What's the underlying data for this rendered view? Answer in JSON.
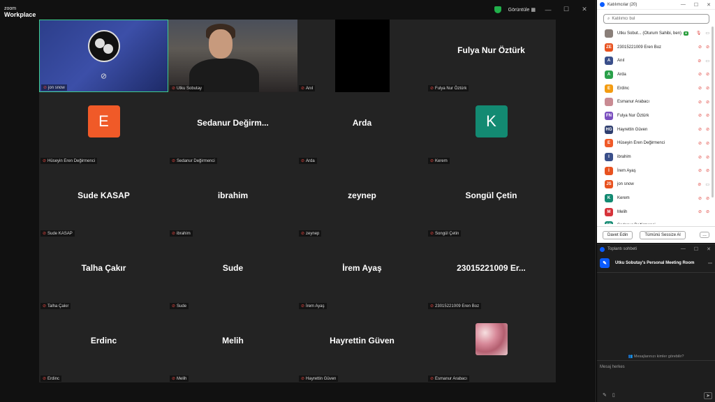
{
  "app": {
    "brand_small": "zoom",
    "brand_big": "Workplace",
    "view_label": "Görüntüle"
  },
  "tiles": [
    {
      "big": "",
      "label": "jon snow",
      "kind": "obs"
    },
    {
      "big": "",
      "label": "Utku Sobutay",
      "kind": "video"
    },
    {
      "big": "",
      "label": "Anıl",
      "kind": "black"
    },
    {
      "big": "Fulya Nur Öztürk",
      "label": "Fulya Nur Öztürk",
      "kind": "name"
    },
    {
      "big": "",
      "label": "Hüseyin Eren Değirmenci",
      "kind": "avatar",
      "letter": "E",
      "color": "#f05a28"
    },
    {
      "big": "Sedanur  Değirm...",
      "label": "Sedanur Değirmenci",
      "kind": "name"
    },
    {
      "big": "Arda",
      "label": "Arda",
      "kind": "name"
    },
    {
      "big": "",
      "label": "Kerem",
      "kind": "avatar",
      "letter": "K",
      "color": "#138a72"
    },
    {
      "big": "Sude KASAP",
      "label": "Sude KASAP",
      "kind": "name"
    },
    {
      "big": "ibrahim",
      "label": "ibrahim",
      "kind": "name"
    },
    {
      "big": "zeynep",
      "label": "zeynep",
      "kind": "name"
    },
    {
      "big": "Songül Çetin",
      "label": "Songül Çetin",
      "kind": "name"
    },
    {
      "big": "Talha Çakır",
      "label": "Talha Çakır",
      "kind": "name"
    },
    {
      "big": "Sude",
      "label": "Sude",
      "kind": "name"
    },
    {
      "big": "İrem Ayaş",
      "label": "İrem Ayaş",
      "kind": "name"
    },
    {
      "big": "23015221009  Er...",
      "label": "23015221009 Eren Boz",
      "kind": "name"
    },
    {
      "big": "Erdinc",
      "label": "Erdinc",
      "kind": "name"
    },
    {
      "big": "Melih",
      "label": "Melih",
      "kind": "name"
    },
    {
      "big": "Hayrettin Güven",
      "label": "Hayrettin Güven",
      "kind": "name"
    },
    {
      "big": "",
      "label": "Esmanur Arabacı",
      "kind": "photo"
    }
  ],
  "participants": {
    "title": "Katılımcılar (20)",
    "search_placeholder": "Katılımcı bul",
    "invite": "Davet Edin",
    "mute_all": "Tümünü Sessize Al",
    "more": "...",
    "list": [
      {
        "init": "",
        "name": "Utku Sobut...  (Oturum Sahibi, ben)",
        "color": "#8a7f79",
        "host": true,
        "cam": true
      },
      {
        "init": "ZE",
        "name": "23015221009 Eren Boz",
        "color": "#e8521f"
      },
      {
        "init": "A",
        "name": "Anıl",
        "color": "#3a4f8a",
        "cam": true
      },
      {
        "init": "A",
        "name": "Arda",
        "color": "#2aa04a"
      },
      {
        "init": "E",
        "name": "Erdinc",
        "color": "#f39c12"
      },
      {
        "init": "",
        "name": "Esmanur Arabacı",
        "color": "#c98b93"
      },
      {
        "init": "FN",
        "name": "Fulya Nur Öztürk",
        "color": "#7a4fbf"
      },
      {
        "init": "HG",
        "name": "Hayrettin Güven",
        "color": "#2f3f6f"
      },
      {
        "init": "E",
        "name": "Hüseyin Eren Değirmenci",
        "color": "#f05a28"
      },
      {
        "init": "I",
        "name": "ibrahim",
        "color": "#3a4f8a"
      },
      {
        "init": "İ",
        "name": "İrem Ayaş",
        "color": "#e8521f"
      },
      {
        "init": "JS",
        "name": "jon snow",
        "color": "#e8521f",
        "cam": true
      },
      {
        "init": "K",
        "name": "Kerem",
        "color": "#138a72"
      },
      {
        "init": "M",
        "name": "Melih",
        "color": "#d6333a"
      },
      {
        "init": "SD",
        "name": "Sedanur Değirmenci",
        "color": "#138a72"
      }
    ]
  },
  "chat": {
    "title": "Toplantı sohbeti",
    "room": "Utku Sobutay's Personal Meeting Room",
    "visibility": "Mesajlarınızı kimler görebilir?",
    "placeholder": "Mesaj herkes"
  }
}
